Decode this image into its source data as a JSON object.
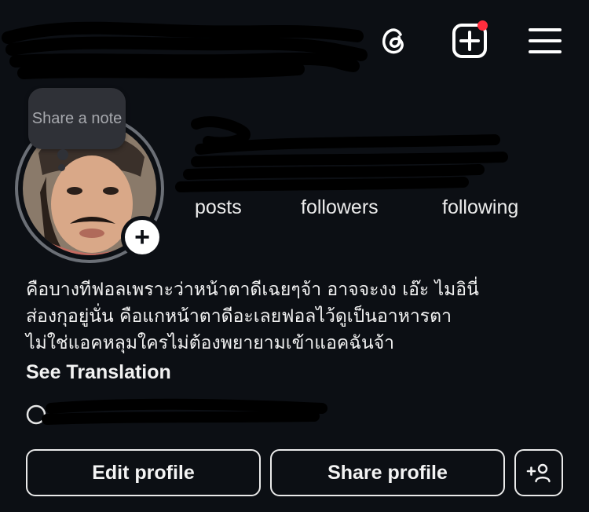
{
  "note": {
    "text": "Share a note"
  },
  "header": {
    "icons": [
      "threads-icon",
      "create-icon",
      "menu-icon"
    ],
    "notification_dot_color": "#ff2d3d"
  },
  "stats": {
    "posts_label": "posts",
    "followers_label": "followers",
    "following_label": "following"
  },
  "bio": {
    "lines": [
      "คือบางทีฟอลเพราะว่าหน้าตาดีเฉยๆจ้า อาจจะงง เอ๊ะ ไมอินี่",
      "ส่องกุอยู่นั่น คือแกหน้าตาดีอะเลยฟอลไว้ดูเป็นอาหารตา",
      "ไม่ใช่แอคหลุมใครไม่ต้องพยายามเข้าแอคฉันจ้า"
    ],
    "see_translation": "See Translation"
  },
  "actions": {
    "edit_profile": "Edit profile",
    "share_profile": "Share profile"
  },
  "colors": {
    "background": "#0c0f14",
    "text": "#f2f2f2",
    "note_bubble": "#2f3137",
    "avatar_ring": "#6b6f76"
  }
}
